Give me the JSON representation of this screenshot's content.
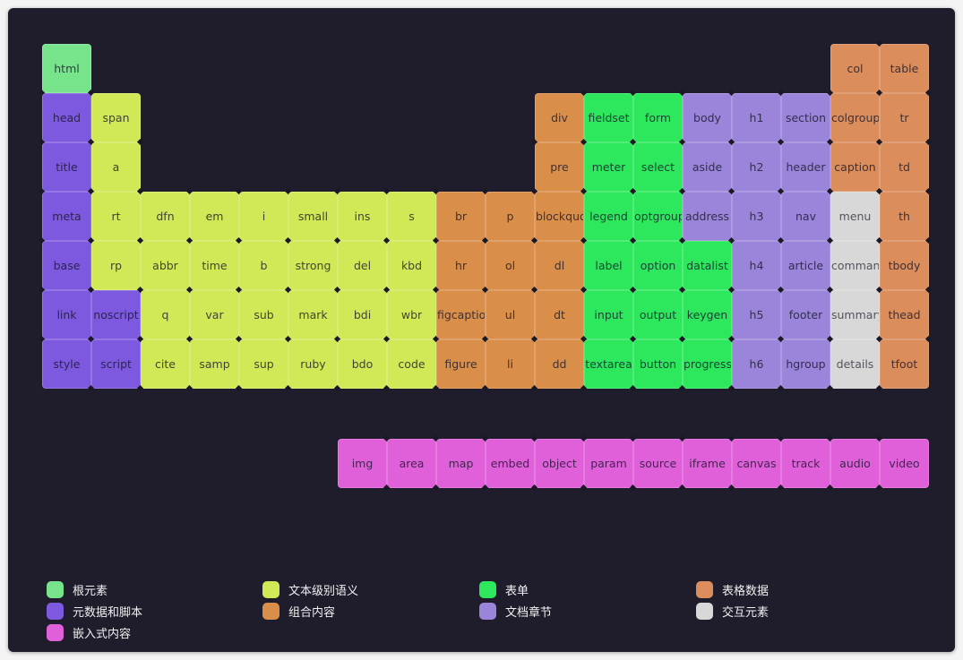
{
  "categories": {
    "root": {
      "label": "根元素",
      "color": "#77e48c"
    },
    "meta": {
      "label": "元数据和脚本",
      "color": "#7d59e0"
    },
    "embedded": {
      "label": "嵌入式内容",
      "color": "#e060da"
    },
    "text": {
      "label": "文本级别语义",
      "color": "#d1e857"
    },
    "group": {
      "label": "组合内容",
      "color": "#d98e4a"
    },
    "form": {
      "label": "表单",
      "color": "#2de85c"
    },
    "section": {
      "label": "文档章节",
      "color": "#9a85da"
    },
    "table": {
      "label": "表格数据",
      "color": "#db8d5b"
    },
    "interactive": {
      "label": "交互元素",
      "color": "#d8d8d8"
    }
  },
  "legend_order": [
    [
      "root",
      "meta",
      "embedded"
    ],
    [
      "text",
      "group"
    ],
    [
      "form",
      "section"
    ],
    [
      "table",
      "interactive"
    ]
  ],
  "elements": [
    {
      "name": "html",
      "cat": "root",
      "row": 0,
      "col": 0
    },
    {
      "name": "col",
      "cat": "table",
      "row": 0,
      "col": 16
    },
    {
      "name": "table",
      "cat": "table",
      "row": 0,
      "col": 17
    },
    {
      "name": "head",
      "cat": "meta",
      "row": 1,
      "col": 0
    },
    {
      "name": "span",
      "cat": "text",
      "row": 1,
      "col": 1
    },
    {
      "name": "div",
      "cat": "group",
      "row": 1,
      "col": 10
    },
    {
      "name": "fieldset",
      "cat": "form",
      "row": 1,
      "col": 11
    },
    {
      "name": "form",
      "cat": "form",
      "row": 1,
      "col": 12
    },
    {
      "name": "body",
      "cat": "section",
      "row": 1,
      "col": 13
    },
    {
      "name": "h1",
      "cat": "section",
      "row": 1,
      "col": 14
    },
    {
      "name": "section",
      "cat": "section",
      "row": 1,
      "col": 15
    },
    {
      "name": "colgroup",
      "cat": "table",
      "row": 1,
      "col": 16
    },
    {
      "name": "tr",
      "cat": "table",
      "row": 1,
      "col": 17
    },
    {
      "name": "title",
      "cat": "meta",
      "row": 2,
      "col": 0
    },
    {
      "name": "a",
      "cat": "text",
      "row": 2,
      "col": 1
    },
    {
      "name": "pre",
      "cat": "group",
      "row": 2,
      "col": 10
    },
    {
      "name": "meter",
      "cat": "form",
      "row": 2,
      "col": 11
    },
    {
      "name": "select",
      "cat": "form",
      "row": 2,
      "col": 12
    },
    {
      "name": "aside",
      "cat": "section",
      "row": 2,
      "col": 13
    },
    {
      "name": "h2",
      "cat": "section",
      "row": 2,
      "col": 14
    },
    {
      "name": "header",
      "cat": "section",
      "row": 2,
      "col": 15
    },
    {
      "name": "caption",
      "cat": "table",
      "row": 2,
      "col": 16
    },
    {
      "name": "td",
      "cat": "table",
      "row": 2,
      "col": 17
    },
    {
      "name": "meta",
      "cat": "meta",
      "row": 3,
      "col": 0
    },
    {
      "name": "rt",
      "cat": "text",
      "row": 3,
      "col": 1
    },
    {
      "name": "dfn",
      "cat": "text",
      "row": 3,
      "col": 2
    },
    {
      "name": "em",
      "cat": "text",
      "row": 3,
      "col": 3
    },
    {
      "name": "i",
      "cat": "text",
      "row": 3,
      "col": 4
    },
    {
      "name": "small",
      "cat": "text",
      "row": 3,
      "col": 5
    },
    {
      "name": "ins",
      "cat": "text",
      "row": 3,
      "col": 6
    },
    {
      "name": "s",
      "cat": "text",
      "row": 3,
      "col": 7
    },
    {
      "name": "br",
      "cat": "group",
      "row": 3,
      "col": 8
    },
    {
      "name": "p",
      "cat": "group",
      "row": 3,
      "col": 9
    },
    {
      "name": "blockquote",
      "cat": "group",
      "row": 3,
      "col": 10
    },
    {
      "name": "legend",
      "cat": "form",
      "row": 3,
      "col": 11
    },
    {
      "name": "optgroup",
      "cat": "form",
      "row": 3,
      "col": 12
    },
    {
      "name": "address",
      "cat": "section",
      "row": 3,
      "col": 13
    },
    {
      "name": "h3",
      "cat": "section",
      "row": 3,
      "col": 14
    },
    {
      "name": "nav",
      "cat": "section",
      "row": 3,
      "col": 15
    },
    {
      "name": "menu",
      "cat": "interactive",
      "row": 3,
      "col": 16
    },
    {
      "name": "th",
      "cat": "table",
      "row": 3,
      "col": 17
    },
    {
      "name": "base",
      "cat": "meta",
      "row": 4,
      "col": 0
    },
    {
      "name": "rp",
      "cat": "text",
      "row": 4,
      "col": 1
    },
    {
      "name": "abbr",
      "cat": "text",
      "row": 4,
      "col": 2
    },
    {
      "name": "time",
      "cat": "text",
      "row": 4,
      "col": 3
    },
    {
      "name": "b",
      "cat": "text",
      "row": 4,
      "col": 4
    },
    {
      "name": "strong",
      "cat": "text",
      "row": 4,
      "col": 5
    },
    {
      "name": "del",
      "cat": "text",
      "row": 4,
      "col": 6
    },
    {
      "name": "kbd",
      "cat": "text",
      "row": 4,
      "col": 7
    },
    {
      "name": "hr",
      "cat": "group",
      "row": 4,
      "col": 8
    },
    {
      "name": "ol",
      "cat": "group",
      "row": 4,
      "col": 9
    },
    {
      "name": "dl",
      "cat": "group",
      "row": 4,
      "col": 10
    },
    {
      "name": "label",
      "cat": "form",
      "row": 4,
      "col": 11
    },
    {
      "name": "option",
      "cat": "form",
      "row": 4,
      "col": 12
    },
    {
      "name": "datalist",
      "cat": "form",
      "row": 4,
      "col": 13
    },
    {
      "name": "h4",
      "cat": "section",
      "row": 4,
      "col": 14
    },
    {
      "name": "article",
      "cat": "section",
      "row": 4,
      "col": 15
    },
    {
      "name": "command",
      "cat": "interactive",
      "row": 4,
      "col": 16
    },
    {
      "name": "tbody",
      "cat": "table",
      "row": 4,
      "col": 17
    },
    {
      "name": "link",
      "cat": "meta",
      "row": 5,
      "col": 0
    },
    {
      "name": "noscript",
      "cat": "meta",
      "row": 5,
      "col": 1
    },
    {
      "name": "q",
      "cat": "text",
      "row": 5,
      "col": 2
    },
    {
      "name": "var",
      "cat": "text",
      "row": 5,
      "col": 3
    },
    {
      "name": "sub",
      "cat": "text",
      "row": 5,
      "col": 4
    },
    {
      "name": "mark",
      "cat": "text",
      "row": 5,
      "col": 5
    },
    {
      "name": "bdi",
      "cat": "text",
      "row": 5,
      "col": 6
    },
    {
      "name": "wbr",
      "cat": "text",
      "row": 5,
      "col": 7
    },
    {
      "name": "figcaption",
      "cat": "group",
      "row": 5,
      "col": 8
    },
    {
      "name": "ul",
      "cat": "group",
      "row": 5,
      "col": 9
    },
    {
      "name": "dt",
      "cat": "group",
      "row": 5,
      "col": 10
    },
    {
      "name": "input",
      "cat": "form",
      "row": 5,
      "col": 11
    },
    {
      "name": "output",
      "cat": "form",
      "row": 5,
      "col": 12
    },
    {
      "name": "keygen",
      "cat": "form",
      "row": 5,
      "col": 13
    },
    {
      "name": "h5",
      "cat": "section",
      "row": 5,
      "col": 14
    },
    {
      "name": "footer",
      "cat": "section",
      "row": 5,
      "col": 15
    },
    {
      "name": "summary",
      "cat": "interactive",
      "row": 5,
      "col": 16
    },
    {
      "name": "thead",
      "cat": "table",
      "row": 5,
      "col": 17
    },
    {
      "name": "style",
      "cat": "meta",
      "row": 6,
      "col": 0
    },
    {
      "name": "script",
      "cat": "meta",
      "row": 6,
      "col": 1
    },
    {
      "name": "cite",
      "cat": "text",
      "row": 6,
      "col": 2
    },
    {
      "name": "samp",
      "cat": "text",
      "row": 6,
      "col": 3
    },
    {
      "name": "sup",
      "cat": "text",
      "row": 6,
      "col": 4
    },
    {
      "name": "ruby",
      "cat": "text",
      "row": 6,
      "col": 5
    },
    {
      "name": "bdo",
      "cat": "text",
      "row": 6,
      "col": 6
    },
    {
      "name": "code",
      "cat": "text",
      "row": 6,
      "col": 7
    },
    {
      "name": "figure",
      "cat": "group",
      "row": 6,
      "col": 8
    },
    {
      "name": "li",
      "cat": "group",
      "row": 6,
      "col": 9
    },
    {
      "name": "dd",
      "cat": "group",
      "row": 6,
      "col": 10
    },
    {
      "name": "textarea",
      "cat": "form",
      "row": 6,
      "col": 11
    },
    {
      "name": "button",
      "cat": "form",
      "row": 6,
      "col": 12
    },
    {
      "name": "progress",
      "cat": "form",
      "row": 6,
      "col": 13
    },
    {
      "name": "h6",
      "cat": "section",
      "row": 6,
      "col": 14
    },
    {
      "name": "hgroup",
      "cat": "section",
      "row": 6,
      "col": 15
    },
    {
      "name": "details",
      "cat": "interactive",
      "row": 6,
      "col": 16
    },
    {
      "name": "tfoot",
      "cat": "table",
      "row": 6,
      "col": 17
    },
    {
      "name": "img",
      "cat": "embedded",
      "row": 8,
      "col": 6
    },
    {
      "name": "area",
      "cat": "embedded",
      "row": 8,
      "col": 7
    },
    {
      "name": "map",
      "cat": "embedded",
      "row": 8,
      "col": 8
    },
    {
      "name": "embed",
      "cat": "embedded",
      "row": 8,
      "col": 9
    },
    {
      "name": "object",
      "cat": "embedded",
      "row": 8,
      "col": 10
    },
    {
      "name": "param",
      "cat": "embedded",
      "row": 8,
      "col": 11
    },
    {
      "name": "source",
      "cat": "embedded",
      "row": 8,
      "col": 12
    },
    {
      "name": "iframe",
      "cat": "embedded",
      "row": 8,
      "col": 13
    },
    {
      "name": "canvas",
      "cat": "embedded",
      "row": 8,
      "col": 14
    },
    {
      "name": "track",
      "cat": "embedded",
      "row": 8,
      "col": 15
    },
    {
      "name": "audio",
      "cat": "embedded",
      "row": 8,
      "col": 16
    },
    {
      "name": "video",
      "cat": "embedded",
      "row": 8,
      "col": 17
    }
  ]
}
